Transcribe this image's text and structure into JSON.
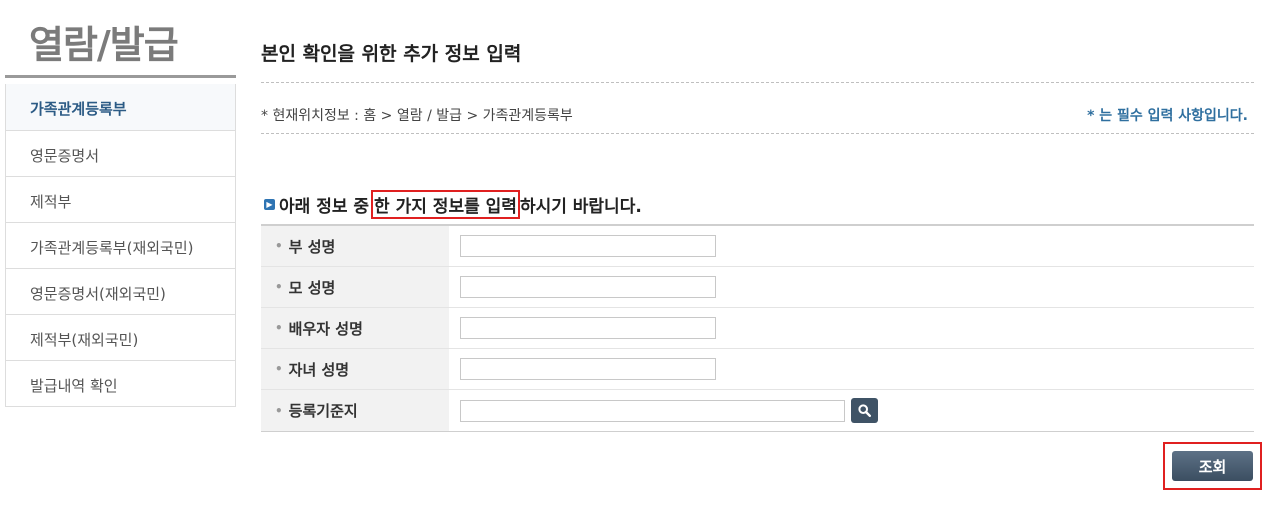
{
  "sidebar": {
    "title": "열람/발급",
    "items": [
      {
        "label": "가족관계등록부",
        "active": true
      },
      {
        "label": "영문증명서"
      },
      {
        "label": "제적부"
      },
      {
        "label": "가족관계등록부(재외국민)"
      },
      {
        "label": "영문증명서(재외국민)"
      },
      {
        "label": "제적부(재외국민)"
      },
      {
        "label": "발급내역 확인"
      }
    ]
  },
  "main": {
    "page_title": "본인 확인을 위한 추가 정보 입력",
    "breadcrumb": "* 현재위치정보 : 홈 > 열람 / 발급 > 가족관계등록부",
    "required_note": "* 는 필수 입력 사항입니다.",
    "instruction": {
      "prefix": "아래 정보 중",
      "highlight": "한 가지 정보를 입력",
      "suffix": "하시기 바랍니다."
    },
    "fields": [
      {
        "label": "부 성명",
        "value": ""
      },
      {
        "label": "모 성명",
        "value": ""
      },
      {
        "label": "배우자 성명",
        "value": ""
      },
      {
        "label": "자녀 성명",
        "value": ""
      },
      {
        "label": "등록기준지",
        "value": ""
      }
    ],
    "submit_label": "조회"
  },
  "colors": {
    "accent": "#2c5b85",
    "highlight_border": "#e02020",
    "button": "#3f5366"
  }
}
